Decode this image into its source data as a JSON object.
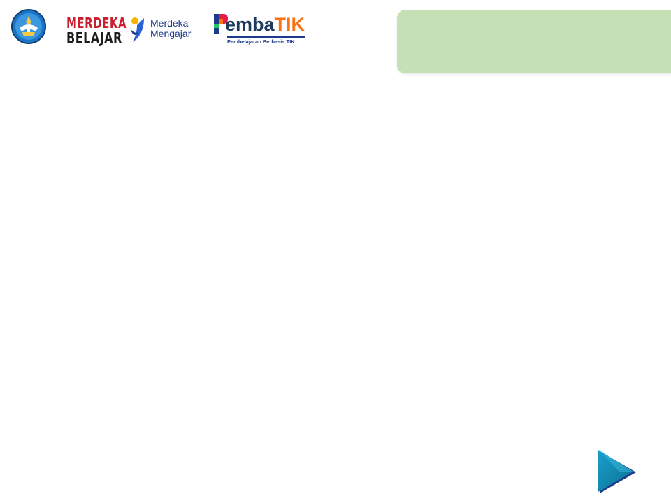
{
  "header": {
    "logos": [
      {
        "name": "tut-wuri-handayani-logo"
      },
      {
        "name": "merdeka-belajar-logo",
        "line1": "MERDEKA",
        "line2": "BELAJAR"
      },
      {
        "name": "merdeka-mengajar-logo",
        "line1": "Merdeka",
        "line2": "Mengajar"
      },
      {
        "name": "pembatik-logo",
        "prefix": "emba",
        "accent": "TIK",
        "tagline": "Pembelajaran Berbasis TIK"
      }
    ]
  },
  "title_box": {
    "text": "",
    "color": "#c5e0b4"
  },
  "navigation": {
    "next_icon": "next-arrow-icon",
    "color": "#0e8fb5"
  }
}
